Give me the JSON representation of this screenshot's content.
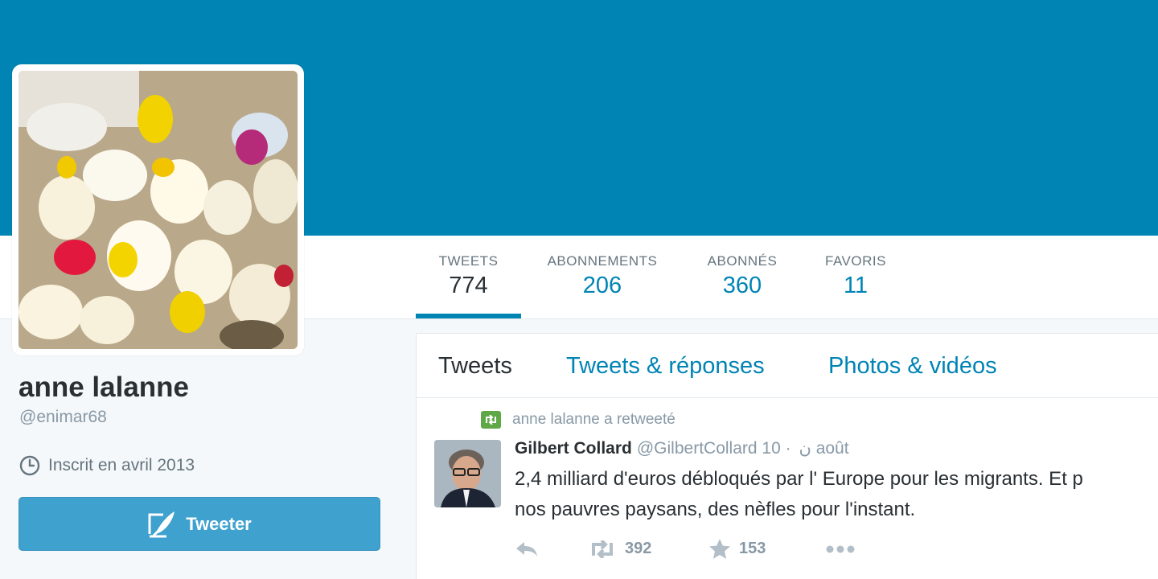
{
  "profile": {
    "name": "anne lalanne",
    "handle": "@enimar68",
    "joined": "Inscrit en avril 2013",
    "tweet_button": "Tweeter"
  },
  "stats": [
    {
      "label": "TWEETS",
      "value": "774"
    },
    {
      "label": "ABONNEMENTS",
      "value": "206"
    },
    {
      "label": "ABONNÉS",
      "value": "360"
    },
    {
      "label": "FAVORIS",
      "value": "11"
    }
  ],
  "timeline": {
    "tabs": [
      "Tweets",
      "Tweets & réponses",
      "Photos & vidéos"
    ],
    "tweet": {
      "retweet_context": "anne lalanne a retweeté",
      "author": "Gilbert Collard",
      "screen_name": "@GilbertCollard",
      "rtl_mark": "ن",
      "time": "· 10 août",
      "text_line1": "2,4 milliard d'euros débloqués par l' Europe pour les migrants. Et p",
      "text_line2": "nos pauvres  paysans, des nèfles pour l'instant.",
      "retweets": "392",
      "favorites": "153"
    }
  },
  "colors": {
    "brand": "#0084b4",
    "button": "#3ea1ce",
    "retweet_green": "#5fa848"
  },
  "icons": [
    "clock-icon",
    "quill-icon",
    "retweet-badge-icon",
    "reply-icon",
    "retweet-icon",
    "star-icon",
    "more-icon"
  ]
}
